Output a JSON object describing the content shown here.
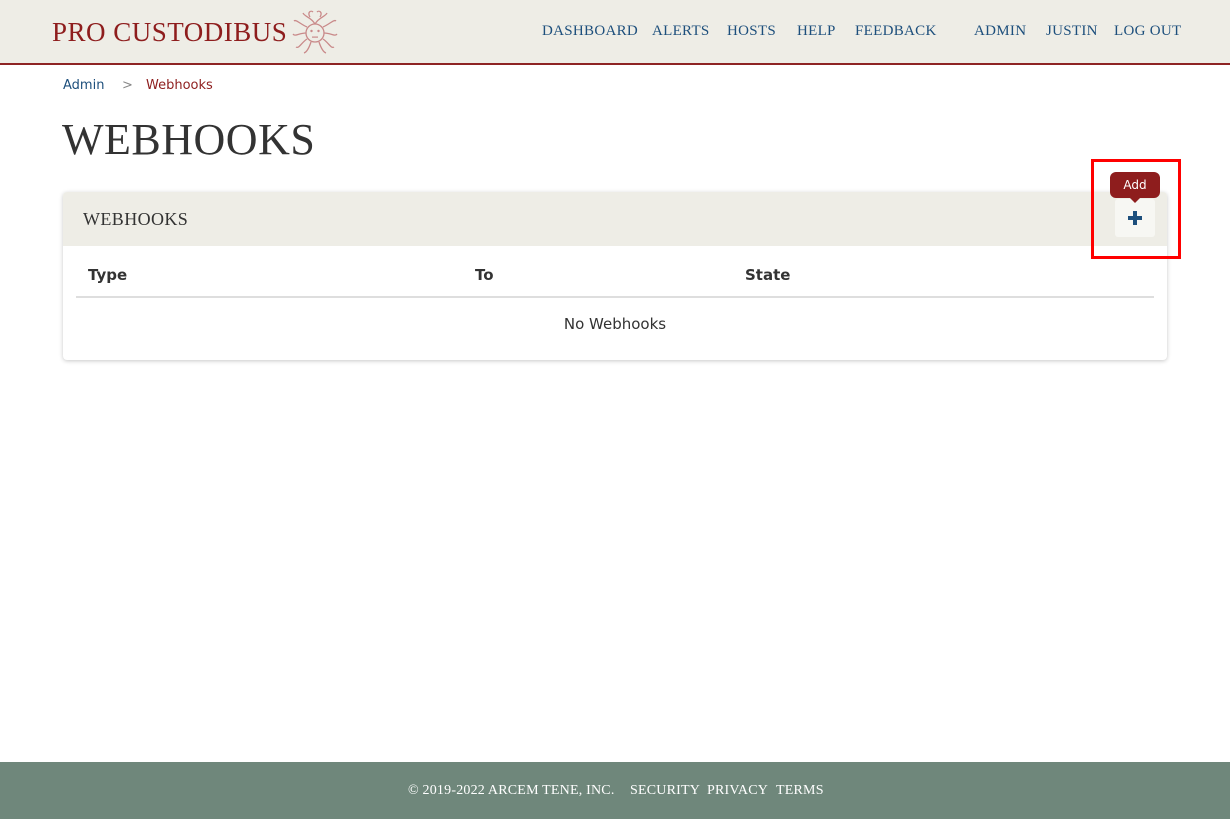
{
  "header": {
    "brand": "PRO CUSTODIBUS",
    "logo_icon": "medusa-head-icon",
    "nav": {
      "dashboard": "DASHBOARD",
      "alerts": "ALERTS",
      "hosts": "HOSTS",
      "help": "HELP",
      "feedback": "FEEDBACK",
      "admin": "ADMIN",
      "user": "JUSTIN",
      "logout": "LOG OUT"
    }
  },
  "breadcrumb": {
    "parent": "Admin",
    "separator": ">",
    "current": "Webhooks"
  },
  "page": {
    "title": "WEBHOOKS"
  },
  "card": {
    "title": "WEBHOOKS",
    "add_tooltip": "Add",
    "add_icon": "plus-icon"
  },
  "table": {
    "columns": [
      "Type",
      "To",
      "State"
    ],
    "empty_message": "No Webhooks"
  },
  "footer": {
    "copyright": "© 2019-2022 ARCEM TENE, INC.",
    "security": "SECURITY",
    "privacy": "PRIVACY",
    "terms": "TERMS"
  },
  "colors": {
    "brand_red": "#8e1d1d",
    "link_blue": "#1d4f7c",
    "header_bg": "#eeede6",
    "footer_bg": "#6f877b",
    "highlight": "#ff0000"
  }
}
